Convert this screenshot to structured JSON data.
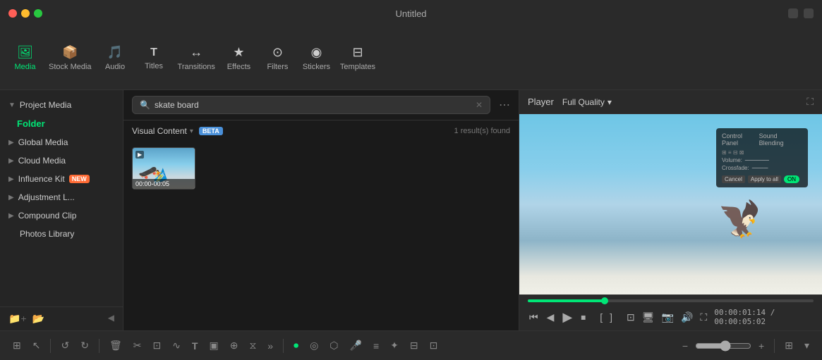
{
  "titlebar": {
    "title": "Untitled",
    "traffic_lights": [
      "red",
      "yellow",
      "green"
    ]
  },
  "nav": {
    "items": [
      {
        "id": "media",
        "label": "Media",
        "icon": "🖼",
        "active": true
      },
      {
        "id": "stock-media",
        "label": "Stock Media",
        "icon": "📦",
        "active": false
      },
      {
        "id": "audio",
        "label": "Audio",
        "icon": "🎵",
        "active": false
      },
      {
        "id": "titles",
        "label": "Titles",
        "icon": "T",
        "active": false
      },
      {
        "id": "transitions",
        "label": "Transitions",
        "icon": "✦",
        "active": false
      },
      {
        "id": "effects",
        "label": "Effects",
        "icon": "★",
        "active": false
      },
      {
        "id": "filters",
        "label": "Filters",
        "icon": "⊙",
        "active": false
      },
      {
        "id": "stickers",
        "label": "Stickers",
        "icon": "◉",
        "active": false
      },
      {
        "id": "templates",
        "label": "Templates",
        "icon": "⊟",
        "active": false
      }
    ]
  },
  "sidebar": {
    "sections": [
      {
        "id": "project-media",
        "label": "Project Media",
        "expanded": true,
        "badge": null
      },
      {
        "id": "folder",
        "label": "Folder",
        "type": "folder"
      },
      {
        "id": "global-media",
        "label": "Global Media",
        "expanded": false,
        "badge": null
      },
      {
        "id": "cloud-media",
        "label": "Cloud Media",
        "expanded": false,
        "badge": null
      },
      {
        "id": "influence-kit",
        "label": "Influence Kit",
        "expanded": false,
        "badge": "NEW"
      },
      {
        "id": "adjustment-l",
        "label": "Adjustment L...",
        "expanded": false,
        "badge": null
      },
      {
        "id": "compound-clip",
        "label": "Compound Clip",
        "expanded": false,
        "badge": null
      },
      {
        "id": "photos-library",
        "label": "Photos Library",
        "expanded": false,
        "badge": null
      }
    ],
    "bottom_icons": [
      "add-folder",
      "folder"
    ]
  },
  "search": {
    "placeholder": "skate board",
    "value": "skate board"
  },
  "content": {
    "filter_label": "Visual Content",
    "filter_arrow": "▾",
    "beta_badge": "BETA",
    "result_count": "1 result(s) found",
    "media_items": [
      {
        "id": "clip-1",
        "duration": "00:00-00:05",
        "type": "video"
      }
    ]
  },
  "player": {
    "label": "Player",
    "quality": "Full Quality",
    "quality_arrow": "▾",
    "time_current": "00:00:01:14",
    "time_total": "00:00:05:02",
    "progress_percent": 27,
    "controls": {
      "rewind": "⏮",
      "step_back": "◀",
      "play": "▶",
      "stop": "⏹",
      "mark_in": "[",
      "mark_out": "]",
      "more": "···"
    }
  },
  "bottom_toolbar": {
    "buttons": [
      {
        "id": "split-view",
        "icon": "⊞",
        "label": "split-view"
      },
      {
        "id": "cursor",
        "icon": "↖",
        "label": "cursor-tool"
      },
      {
        "id": "undo",
        "icon": "↺",
        "label": "undo"
      },
      {
        "id": "redo",
        "icon": "↻",
        "label": "redo"
      },
      {
        "id": "delete",
        "icon": "🗑",
        "label": "delete"
      },
      {
        "id": "cut",
        "icon": "✂",
        "label": "cut"
      },
      {
        "id": "crop",
        "icon": "⊡",
        "label": "crop"
      },
      {
        "id": "audio-wave",
        "icon": "∿",
        "label": "audio-wave"
      },
      {
        "id": "text",
        "icon": "T",
        "label": "text"
      },
      {
        "id": "shape",
        "icon": "▣",
        "label": "shape"
      },
      {
        "id": "link",
        "icon": "⊕",
        "label": "link"
      },
      {
        "id": "speed",
        "icon": "⧖",
        "label": "speed"
      },
      {
        "id": "more-tools",
        "icon": "»",
        "label": "more-tools"
      },
      {
        "id": "record",
        "icon": "⏺",
        "label": "record",
        "active": true
      },
      {
        "id": "ripple",
        "icon": "◎",
        "label": "ripple"
      },
      {
        "id": "marker",
        "icon": "⬡",
        "label": "marker"
      },
      {
        "id": "mic",
        "icon": "🎤",
        "label": "mic"
      },
      {
        "id": "track",
        "icon": "≡",
        "label": "track"
      },
      {
        "id": "ai",
        "icon": "✦",
        "label": "ai-tools"
      },
      {
        "id": "captions",
        "icon": "⊟",
        "label": "captions"
      },
      {
        "id": "subtitle",
        "icon": "⊡",
        "label": "subtitle"
      },
      {
        "id": "zoom-out",
        "icon": "−",
        "label": "zoom-out"
      },
      {
        "id": "zoom-in",
        "icon": "+",
        "label": "zoom-in"
      },
      {
        "id": "grid",
        "icon": "⊞",
        "label": "grid-view"
      }
    ]
  }
}
